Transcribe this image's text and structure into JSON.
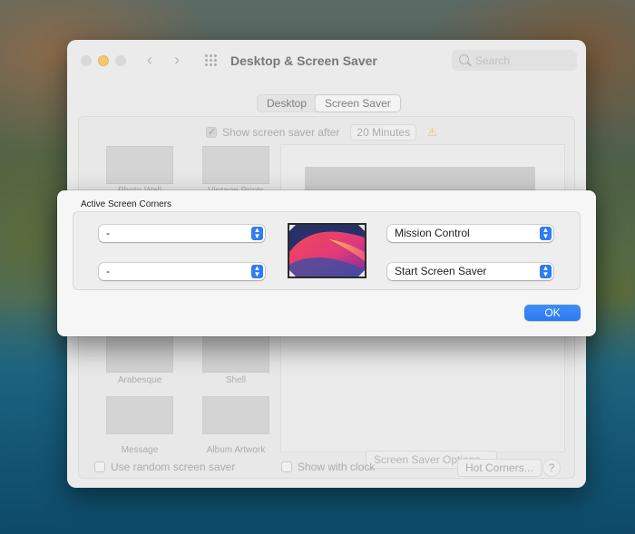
{
  "window": {
    "title": "Desktop & Screen Saver",
    "search_placeholder": "Search",
    "tabs": [
      "Desktop",
      "Screen Saver"
    ],
    "active_tab": "Screen Saver"
  },
  "screen_saver": {
    "show_after_label": "Show screen saver after",
    "show_after_checked": true,
    "show_after_value": "20 Minutes",
    "savers": [
      "Photo Wall",
      "Vintage Prints",
      "Arabesque",
      "Shell",
      "Message",
      "Album Artwork"
    ],
    "options_button": "Screen Saver Options...",
    "use_random_label": "Use random screen saver",
    "show_clock_label": "Show with clock",
    "hot_corners_button": "Hot Corners...",
    "help_button": "?"
  },
  "hot_corners_sheet": {
    "title": "Active Screen Corners",
    "top_left": "-",
    "bottom_left": "-",
    "top_right": "Mission Control",
    "bottom_right": "Start Screen Saver",
    "ok_button": "OK"
  },
  "colors": {
    "accent": "#2f7cf6",
    "minimize": "#f5b52a"
  }
}
